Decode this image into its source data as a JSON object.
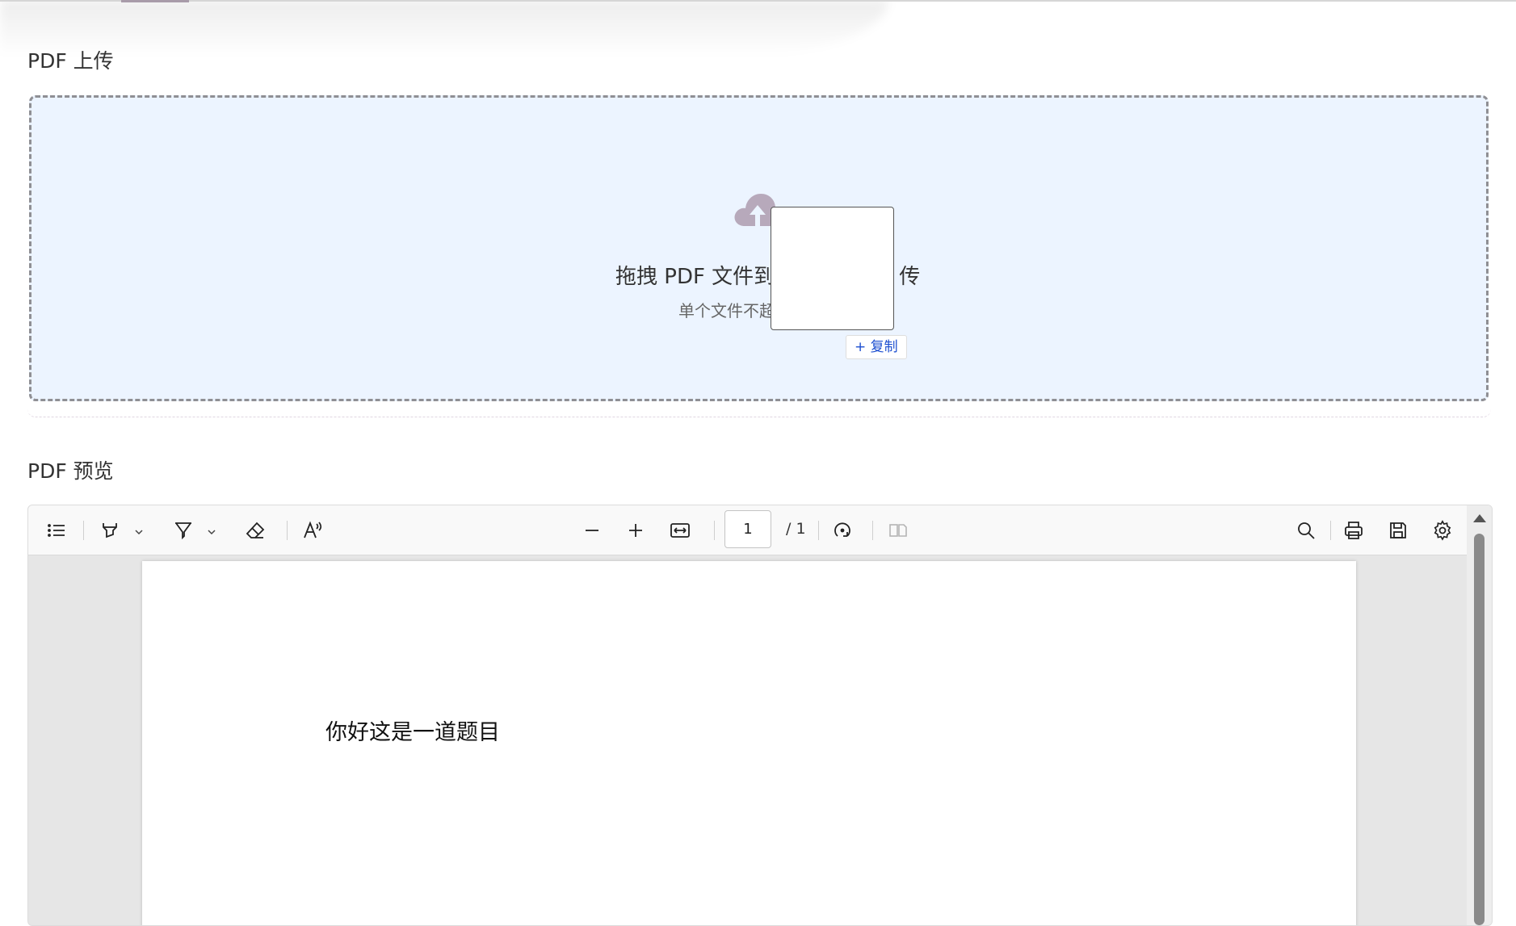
{
  "upload_section": {
    "title": "PDF 上传",
    "drop_main_left": "拖拽 PDF 文件到",
    "drop_main_right": "传",
    "drop_sub": "单个文件不超",
    "icon": "cloud-upload-icon"
  },
  "drag_feedback": {
    "copy_label": "+ 复制"
  },
  "preview_section": {
    "title": "PDF 预览"
  },
  "viewer": {
    "toolbar": {
      "outline_icon": "list-icon",
      "highlight_icon": "highlighter-icon",
      "draw_icon": "pen-icon",
      "eraser_icon": "eraser-icon",
      "read_aloud_icon": "read-aloud-icon",
      "zoom_out_icon": "minus-icon",
      "zoom_in_icon": "plus-icon",
      "fit_icon": "fit-width-icon",
      "page_value": "1",
      "page_total": "/ 1",
      "rotate_icon": "rotate-icon",
      "two_page_icon": "two-page-icon",
      "search_icon": "search-icon",
      "print_icon": "print-icon",
      "save_icon": "save-icon",
      "settings_icon": "gear-icon"
    },
    "page_text": "你好这是一道题目"
  },
  "colors": {
    "dropzone_bg": "#ecf4ff",
    "cloud": "#b7a9bb",
    "copy_text": "#1d4fd0"
  }
}
